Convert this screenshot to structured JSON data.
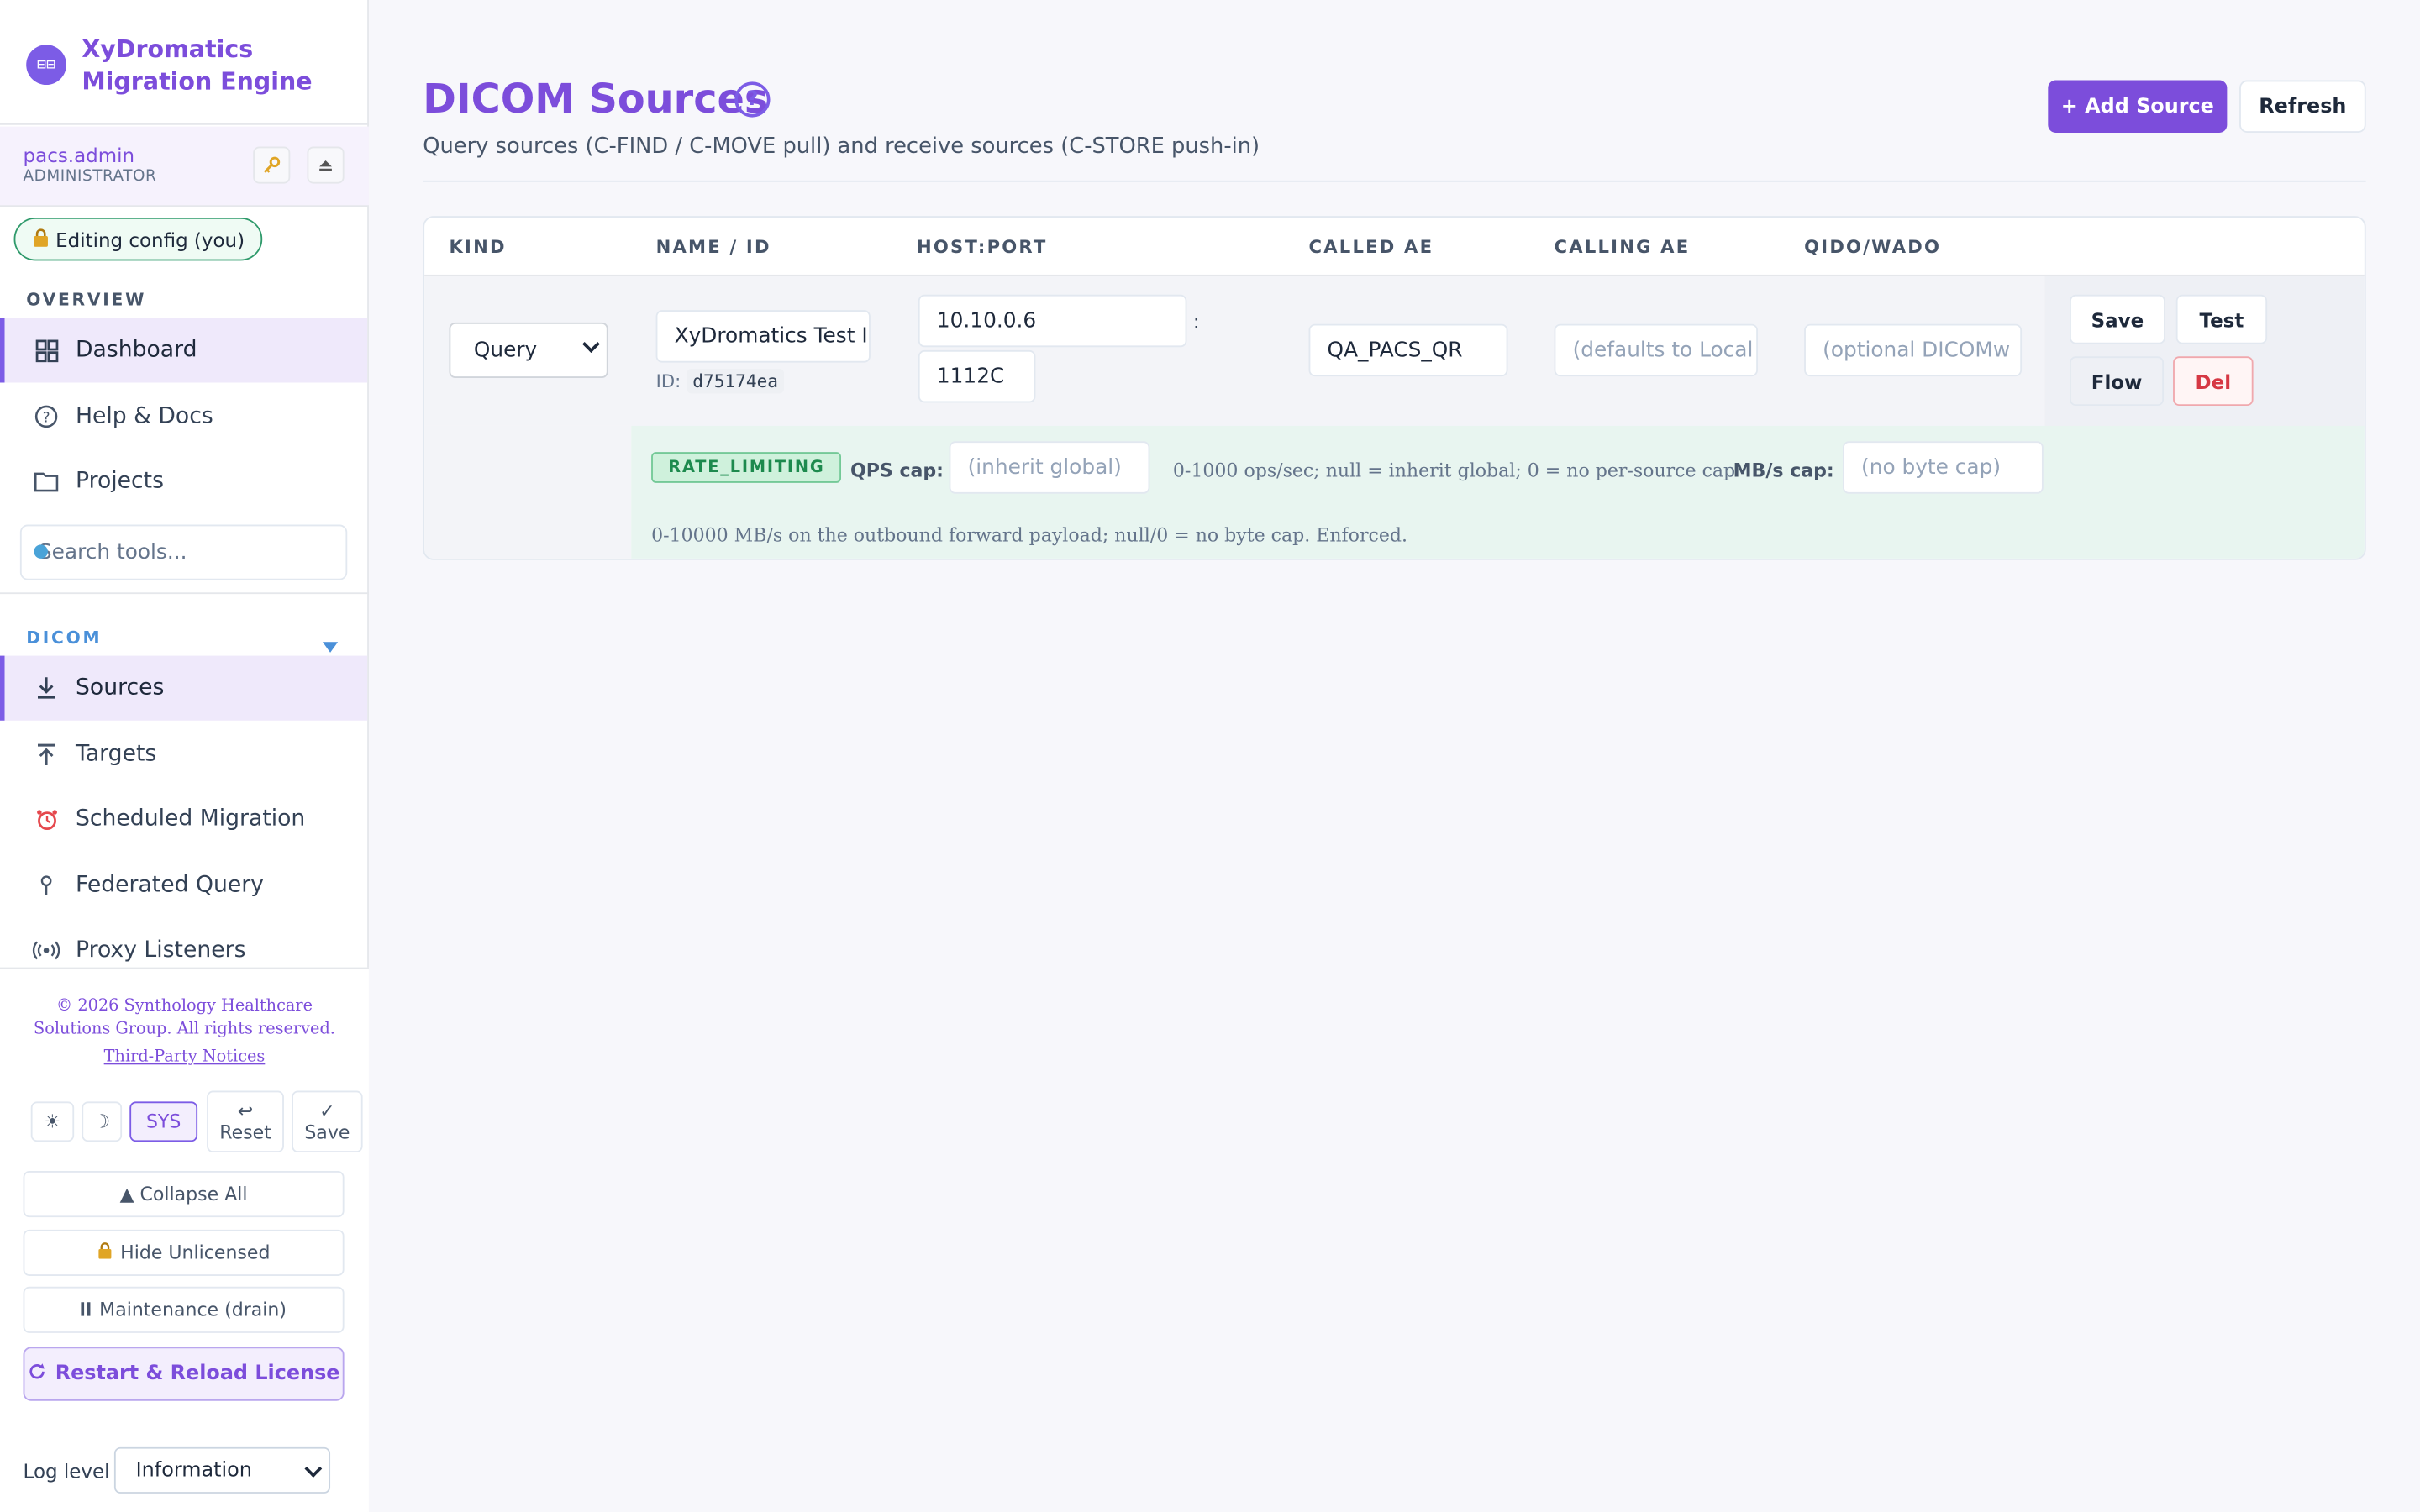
{
  "brand": {
    "name_line1": "XyDromatics",
    "name_line2": "Migration Engine",
    "logo_glyph": "⊟⊟"
  },
  "user": {
    "name": "pacs.admin",
    "role": "ADMINISTRATOR"
  },
  "edit_pill": {
    "label": "Editing config (you)"
  },
  "sidebar": {
    "overview_label": "OVERVIEW",
    "overview_items": [
      {
        "label": "Dashboard",
        "icon": "grid-icon"
      },
      {
        "label": "Help & Docs",
        "icon": "help-circle-icon"
      },
      {
        "label": "Projects",
        "icon": "folder-icon"
      }
    ],
    "search_placeholder": "Search tools...",
    "dicom_label": "DICOM",
    "dicom_items": [
      {
        "label": "Sources",
        "icon": "download-icon"
      },
      {
        "label": "Targets",
        "icon": "upload-icon"
      },
      {
        "label": "Scheduled Migration",
        "icon": "alarm-clock-icon"
      },
      {
        "label": "Federated Query",
        "icon": "pin-icon"
      },
      {
        "label": "Proxy Listeners",
        "icon": "broadcast-icon"
      }
    ]
  },
  "footer": {
    "copyright_line1": "© 2026 Synthology Healthcare",
    "copyright_line2": "Solutions Group. All rights reserved.",
    "notices": "Third-Party Notices",
    "theme_light": "☀",
    "theme_dark": "☽",
    "theme_sys": "SYS",
    "reset_icon": "↩",
    "reset": "Reset",
    "save_icon": "✓",
    "save": "Save",
    "collapse_all": "▲ Collapse All",
    "hide_unlicensed": "Hide Unlicensed",
    "maintenance": "Maintenance (drain)",
    "restart": "Restart & Reload License",
    "log_level_label": "Log level",
    "log_level_value": "Information"
  },
  "page": {
    "title": "DICOM Sources",
    "help": "?",
    "subtitle": "Query sources (C-FIND / C-MOVE pull) and receive sources (C-STORE push-in)",
    "add_button": "+ Add Source",
    "refresh_button": "Refresh"
  },
  "table": {
    "headers": [
      "KIND",
      "NAME / ID",
      "HOST:PORT",
      "CALLED AE",
      "CALLING AE",
      "QIDO/WADO"
    ],
    "row": {
      "kind": "Query",
      "name": "XyDromatics Test I",
      "id_label": "ID:",
      "id": "d75174ea",
      "host": "10.10.0.6",
      "port": "1112C",
      "colon": ":",
      "called_ae": "QA_PACS_QR",
      "calling_ae_placeholder": "(defaults to Local",
      "qido_placeholder": "(optional DICOMw",
      "actions": {
        "save": "Save",
        "test": "Test",
        "flow": "Flow",
        "del": "Del"
      }
    },
    "rate": {
      "badge": "RATE_LIMITING",
      "qps_label": "QPS cap:",
      "qps_placeholder": "(inherit global)",
      "qps_hint": "0-1000 ops/sec; null = inherit global; 0 = no per-source cap",
      "mbs_label": "MB/s cap:",
      "mbs_placeholder": "(no byte cap)",
      "mbs_hint": "0-10000 MB/s on the outbound forward payload; null/0 = no byte cap. Enforced."
    }
  },
  "colors": {
    "accent": "#7c4ddb",
    "success": "#1d8a4e",
    "danger": "#d63844"
  }
}
